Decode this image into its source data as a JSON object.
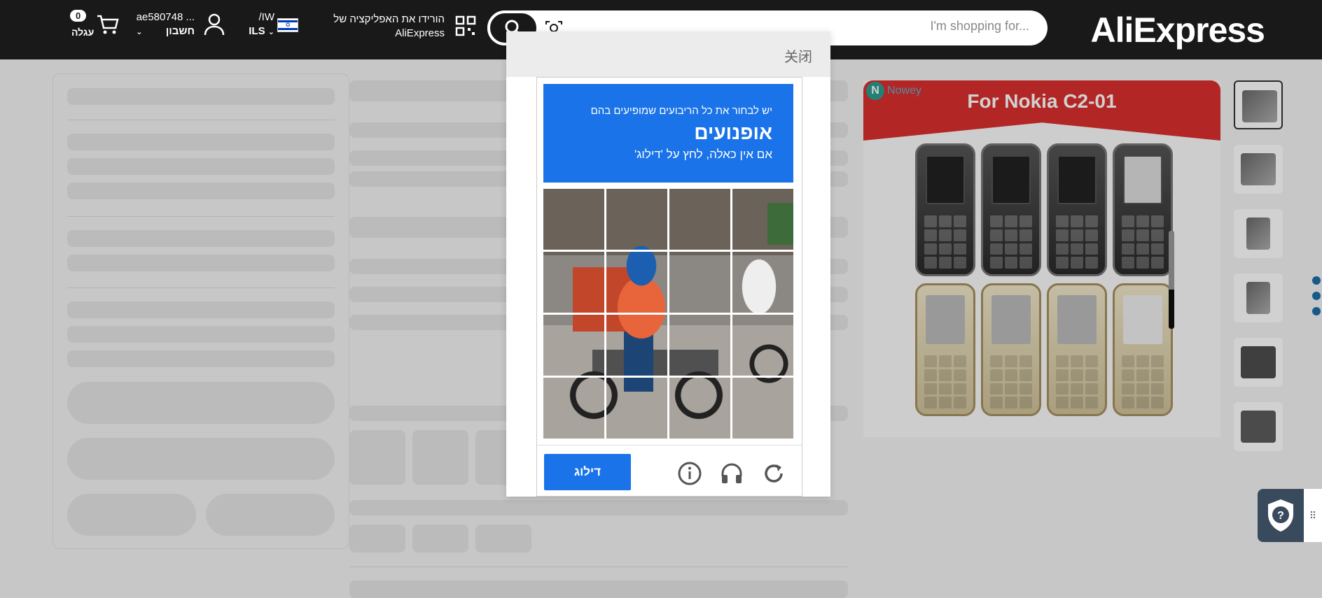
{
  "header": {
    "logo": "AliExpress",
    "search_placeholder": "I'm shopping for...",
    "app_download_line1": "הורידו את האפליקציה של",
    "app_download_line2": "AliExpress",
    "lang_line1": "/IW",
    "lang_line2": "ILS",
    "account_line1": "ae580748 ...",
    "account_line2": "חשבון",
    "cart_count": "0",
    "cart_label": "עגלה"
  },
  "product": {
    "brand": "Nowey",
    "banner_title": "For Nokia C2-01",
    "thumbnail_count": 6
  },
  "captcha": {
    "close_label": "关闭",
    "instruction_line1": "יש לבחור את כל הריבועים שמופיעים בהם",
    "instruction_object": "אופנועים",
    "instruction_line3": "אם אין כאלה, לחץ על 'דילוג'",
    "skip_button": "דילוג",
    "grid_rows": 4,
    "grid_cols": 4,
    "icons": [
      "reload-icon",
      "audio-icon",
      "info-icon"
    ]
  },
  "colors": {
    "header_bg": "#191919",
    "captcha_blue": "#1a73e8",
    "banner_red": "#d9302e"
  }
}
